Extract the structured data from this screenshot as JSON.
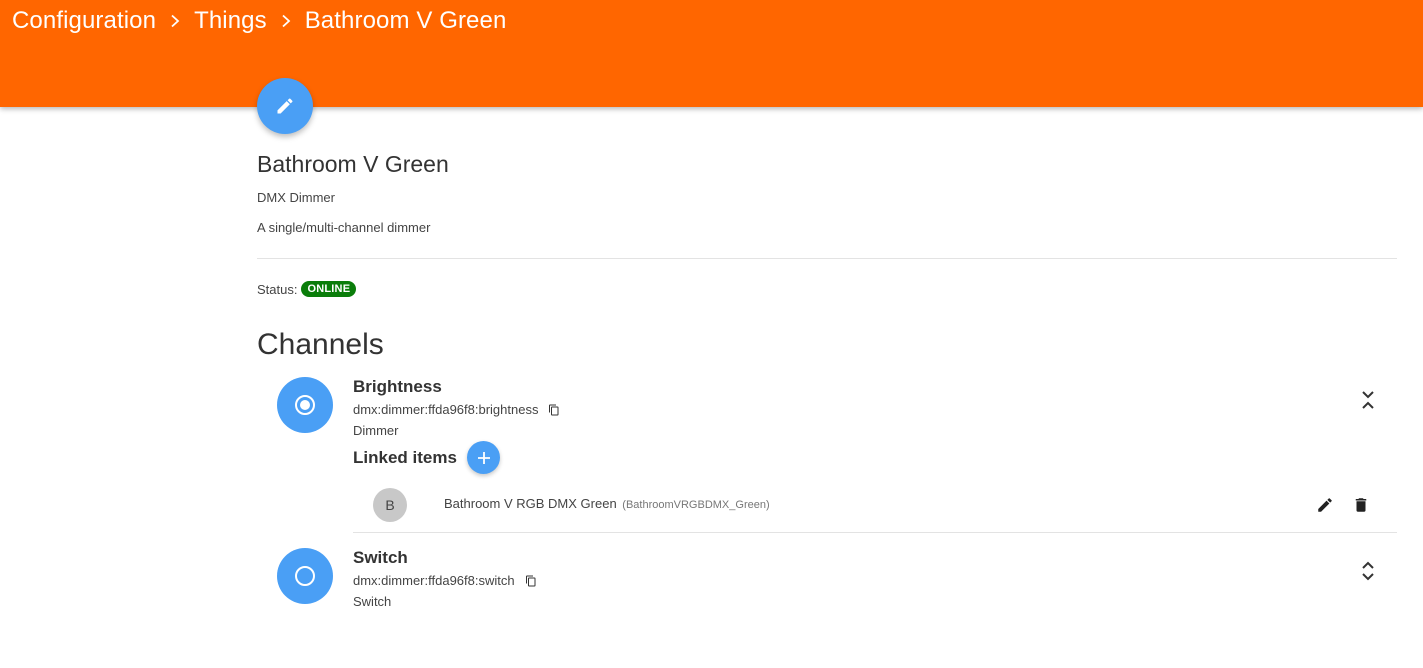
{
  "breadcrumb": {
    "items": [
      "Configuration",
      "Things",
      "Bathroom V Green"
    ]
  },
  "thing": {
    "name": "Bathroom V Green",
    "type": "DMX Dimmer",
    "description": "A single/multi-channel dimmer",
    "status_label": "Status:",
    "status": "ONLINE"
  },
  "channels": {
    "title": "Channels",
    "list": [
      {
        "name": "Brightness",
        "uid": "dmx:dimmer:ffda96f8:brightness",
        "kind": "Dimmer",
        "icon": "radio-checked-icon",
        "expanded": true,
        "linked_title": "Linked items",
        "linked_items": [
          {
            "avatar": "B",
            "label": "Bathroom V RGB DMX Green",
            "id": "(BathroomVRGBDMX_Green)"
          }
        ]
      },
      {
        "name": "Switch",
        "uid": "dmx:dimmer:ffda96f8:switch",
        "kind": "Switch",
        "icon": "radio-unchecked-icon",
        "expanded": false
      }
    ]
  },
  "colors": {
    "header": "#ff6600",
    "accent": "#4a9ff5",
    "online": "#0a7d0a"
  }
}
